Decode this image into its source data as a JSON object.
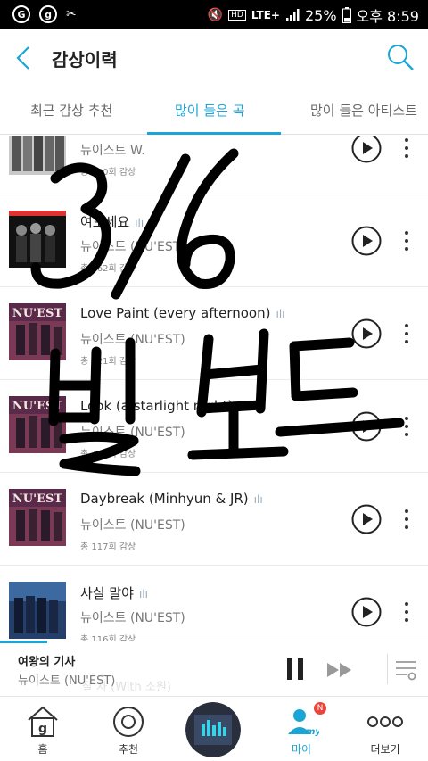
{
  "status_bar": {
    "battery": "25%",
    "time": "오후 8:59",
    "network": "LTE+",
    "hd": "HD"
  },
  "header": {
    "title": "감상이력"
  },
  "tabs": [
    {
      "label": "최근 감상 추천",
      "active": false
    },
    {
      "label": "많이 들은 곡",
      "active": true
    },
    {
      "label": "많이 들은 아티스트",
      "active": false
    }
  ],
  "songs": [
    {
      "title": "",
      "artist": "뉴이스트 W.",
      "count": "총 260회 감상",
      "thumb": "w"
    },
    {
      "title": "여보세요",
      "artist": "뉴이스트 (NU'EST)",
      "count": "총 162회 감상",
      "thumb": "dark"
    },
    {
      "title": "Love Paint (every afternoon)",
      "artist": "뉴이스트 (NU'EST)",
      "count": "총 121회 감상",
      "thumb": "nuest"
    },
    {
      "title": "Look (a starlight night)",
      "artist": "뉴이스트 (NU'EST)",
      "count": "총 118회 감상",
      "thumb": "nuest"
    },
    {
      "title": "Daybreak (Minhyun & JR)",
      "artist": "뉴이스트 (NU'EST)",
      "count": "총 117회 감상",
      "thumb": "nuest"
    },
    {
      "title": "사실 말야",
      "artist": "뉴이스트 (NU'EST)",
      "count": "총 116회 감상",
      "thumb": "blue"
    }
  ],
  "mini_player": {
    "title": "여왕의 기사",
    "artist": "뉴이스트 (NU'EST)",
    "progress": 0.11,
    "behind_text": "잘 자 (With 소원)"
  },
  "bottom_nav": [
    {
      "label": "홈",
      "icon": "home-icon",
      "active": false
    },
    {
      "label": "추천",
      "icon": "recommend-disc-icon",
      "active": false
    },
    {
      "label": "",
      "icon": "now-playing-disc",
      "active": false
    },
    {
      "label": "마이",
      "icon": "my-profile-icon",
      "active": true,
      "badge": "N"
    },
    {
      "label": "더보기",
      "icon": "more-dots-icon",
      "active": false
    }
  ],
  "handwriting": {
    "line1": "3/6",
    "line2": "빌보드"
  },
  "colors": {
    "accent": "#19a6d6",
    "status_bar": "#000000",
    "badge": "#e8453c"
  }
}
